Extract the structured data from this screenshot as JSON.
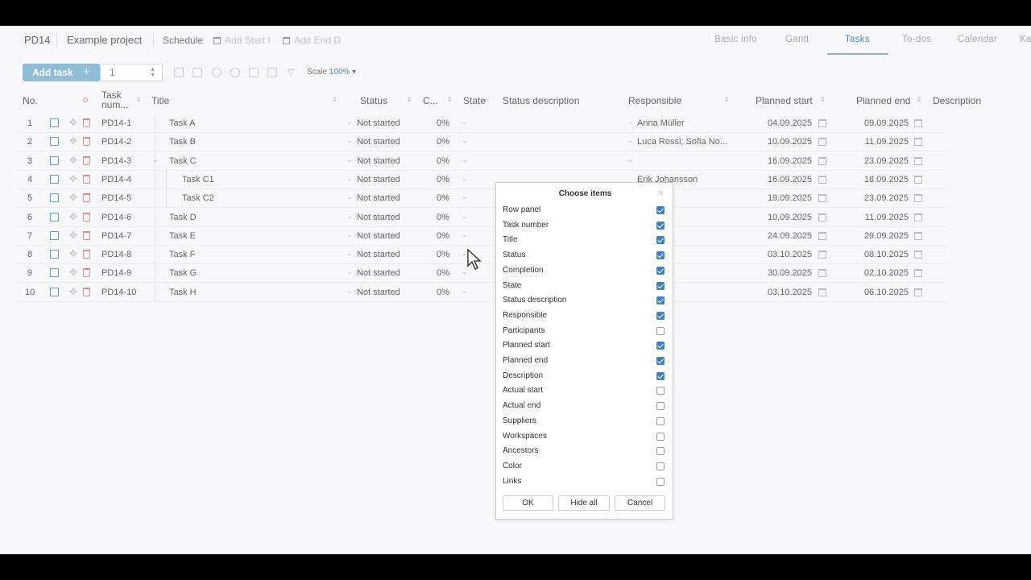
{
  "header": {
    "project_code": "PD14",
    "project_name": "Example project",
    "schedule": "Schedule",
    "add_start": "Add Start I",
    "add_end": "Add End D",
    "tabs": [
      "Basic info",
      "Gantt",
      "Tasks",
      "To-dos",
      "Calendar",
      "Ka"
    ],
    "active_tab": "Tasks"
  },
  "toolbar": {
    "add_task_label": "Add task",
    "count_value": "1",
    "scale_label": "Scale",
    "scale_value": "100%"
  },
  "columns": {
    "no": "No.",
    "task_number": "Task num...",
    "title": "Title",
    "status": "Status",
    "completion": "C...",
    "state": "State",
    "status_description": "Status description",
    "responsible": "Responsible",
    "planned_start": "Planned start",
    "planned_end": "Planned end",
    "description": "Description"
  },
  "rows": [
    {
      "no": "1",
      "num": "PD14-1",
      "title": "Task A",
      "status": "Not started",
      "completion": "0%",
      "responsible": "Anna Müller",
      "start": "04.09.2025",
      "end": "09.09.2025"
    },
    {
      "no": "2",
      "num": "PD14-2",
      "title": "Task B",
      "status": "Not started",
      "completion": "0%",
      "responsible": "Luca Rossi; Sofia No...",
      "start": "10.09.2025",
      "end": "11.09.2025"
    },
    {
      "no": "3",
      "num": "PD14-3",
      "title": "Task C",
      "status": "Not started",
      "completion": "0%",
      "responsible": "",
      "start": "16.09.2025",
      "end": "23.09.2025"
    },
    {
      "no": "4",
      "num": "PD14-4",
      "title": "Task C1",
      "status": "Not started",
      "completion": "0%",
      "responsible": "Erik Johansson",
      "start": "16.09.2025",
      "end": "18.09.2025"
    },
    {
      "no": "5",
      "num": "PD14-5",
      "title": "Task C2",
      "status": "Not started",
      "completion": "0%",
      "responsible": "",
      "start": "19.09.2025",
      "end": "23.09.2025"
    },
    {
      "no": "6",
      "num": "PD14-6",
      "title": "Task D",
      "status": "Not started",
      "completion": "0%",
      "responsible": "",
      "start": "10.09.2025",
      "end": "11.09.2025"
    },
    {
      "no": "7",
      "num": "PD14-7",
      "title": "Task E",
      "status": "Not started",
      "completion": "0%",
      "responsible": "",
      "start": "24.09.2025",
      "end": "29.09.2025"
    },
    {
      "no": "8",
      "num": "PD14-8",
      "title": "Task F",
      "status": "Not started",
      "completion": "0%",
      "responsible": "",
      "start": "03.10.2025",
      "end": "08.10.2025"
    },
    {
      "no": "9",
      "num": "PD14-9",
      "title": "Task G",
      "status": "Not started",
      "completion": "0%",
      "responsible": "",
      "start": "30.09.2025",
      "end": "02.10.2025"
    },
    {
      "no": "10",
      "num": "PD14-10",
      "title": "Task H",
      "status": "Not started",
      "completion": "0%",
      "responsible": "",
      "start": "03.10.2025",
      "end": "06.10.2025"
    }
  ],
  "dialog": {
    "title": "Choose items",
    "items": [
      {
        "label": "Row panel",
        "checked": true
      },
      {
        "label": "Task number",
        "checked": true
      },
      {
        "label": "Title",
        "checked": true
      },
      {
        "label": "Status",
        "checked": true
      },
      {
        "label": "Completion",
        "checked": true
      },
      {
        "label": "State",
        "checked": true
      },
      {
        "label": "Status description",
        "checked": true
      },
      {
        "label": "Responsible",
        "checked": true
      },
      {
        "label": "Participants",
        "checked": false
      },
      {
        "label": "Planned start",
        "checked": true
      },
      {
        "label": "Planned end",
        "checked": true
      },
      {
        "label": "Description",
        "checked": true
      },
      {
        "label": "Actual start",
        "checked": false
      },
      {
        "label": "Actual end",
        "checked": false
      },
      {
        "label": "Suppliers",
        "checked": false
      },
      {
        "label": "Workspaces",
        "checked": false
      },
      {
        "label": "Ancestors",
        "checked": false
      },
      {
        "label": "Color",
        "checked": false
      },
      {
        "label": "Links",
        "checked": false
      }
    ],
    "ok_label": "OK",
    "hide_all_label": "Hide all",
    "cancel_label": "Cancel"
  }
}
